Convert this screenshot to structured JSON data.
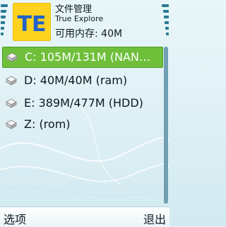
{
  "header": {
    "title": "文件管理",
    "subtitle": "True Explore",
    "free_memory": "可用内存: 40M",
    "logo_text": "TE"
  },
  "drives": [
    {
      "label": "C: 105M/131M (NAN…",
      "selected": true
    },
    {
      "label": "D: 40M/40M (ram)",
      "selected": false
    },
    {
      "label": "E: 389M/477M (HDD)",
      "selected": false
    },
    {
      "label": "Z: (rom)",
      "selected": false
    }
  ],
  "softkeys": {
    "left": "选项",
    "right": "退出"
  },
  "colors": {
    "selection": "#6fbf3b",
    "logo_bg": "#ffd21f",
    "logo_text": "#1f63c9",
    "softkey_bar": "#ffffff"
  },
  "icons": {
    "drive": "disk-drive-icon",
    "signal": "signal-strength-icon",
    "battery": "battery-level-icon"
  }
}
